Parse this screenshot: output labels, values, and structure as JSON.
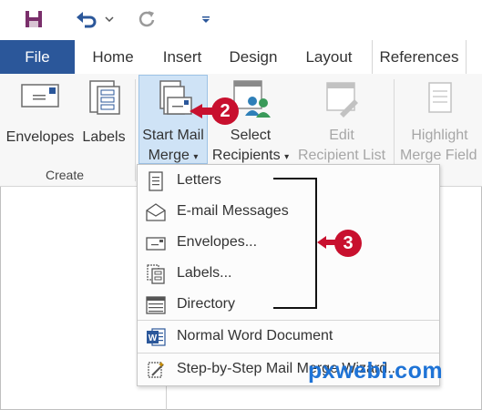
{
  "qat": {
    "save_icon": "save-icon",
    "undo_icon": "undo-icon",
    "redo_icon": "repeat-icon",
    "customize_icon": "customize-qat-icon"
  },
  "tabs": {
    "file": "File",
    "home": "Home",
    "insert": "Insert",
    "design": "Design",
    "layout": "Layout",
    "references": "References"
  },
  "ribbon": {
    "envelopes": "Envelopes",
    "labels": "Labels",
    "create_group": "Create",
    "start_mail_line1": "Start Mail",
    "start_mail_line2": "Merge",
    "select_line1": "Select",
    "select_line2": "Recipients",
    "edit_line1": "Edit",
    "edit_line2": "Recipient List",
    "highlight_line1": "Highlight",
    "highlight_line2": "Merge Field"
  },
  "menu": {
    "letters": "Letters",
    "email": "E-mail Messages",
    "envelopes": "Envelopes...",
    "labels": "Labels...",
    "directory": "Directory",
    "normal": "Normal Word Document",
    "wizard": "Step-by-Step Mail Merge Wizard..."
  },
  "callouts": {
    "step2": "2",
    "step3": "3"
  },
  "watermark": "pxwebi.com",
  "colors": {
    "accent": "#2b579a",
    "callout": "#c8102e",
    "highlight": "#cfe3f6",
    "watermark": "#1e73d6"
  }
}
